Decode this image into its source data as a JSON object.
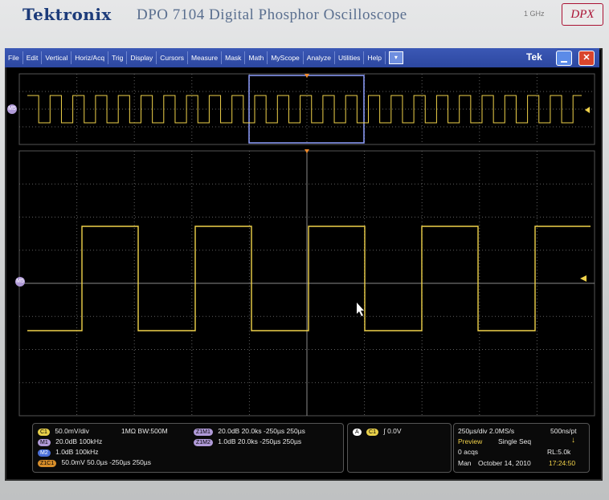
{
  "bezel": {
    "brand": "Tektronix",
    "model": "DPO 7104 Digital Phosphor Oscilloscope",
    "bandwidth": "1 GHz",
    "dpx_logo": "DPX"
  },
  "menu": [
    "File",
    "Edit",
    "Vertical",
    "Horiz/Acq",
    "Trig",
    "Display",
    "Cursors",
    "Measure",
    "Mask",
    "Math",
    "MyScope",
    "Analyze",
    "Utilities",
    "Help"
  ],
  "menu_dropdown_icon": "chevron-down-icon",
  "tek_label": "Tek",
  "close_label": "✕",
  "markers": {
    "zoom_marker": "M5",
    "main_marker": "M5"
  },
  "colors": {
    "trace": "#f0d24a",
    "grid": "#606060",
    "menubar": "#2c47a0",
    "zoom_box": "#8fa0ff"
  },
  "panel_left": {
    "c1": {
      "badge": "C1",
      "text": "50.0mV/div",
      "extra": "1MΩ  BW:500M"
    },
    "m1": {
      "badge": "M1",
      "text": "20.0dB  100kHz"
    },
    "m2": {
      "badge": "M2",
      "text": "1.0dB   100kHz"
    },
    "z1": {
      "badge": "Z1M1",
      "text": "20.0dB  20.0ks  -250µs   250µs"
    },
    "z2": {
      "badge": "Z1M2",
      "text": "1.0dB   20.0ks  -250µs   250µs"
    },
    "z3": {
      "badge": "Z1C1",
      "text": "50.0mV 50.0µs  -250µs   250µs"
    }
  },
  "panel_mid": {
    "badge_a": "A",
    "badge_c1": "C1",
    "trigger_text": "0.0V"
  },
  "panel_right": {
    "timebase": "250µs/div  2.0MS/s",
    "pts": "500ns/pt",
    "preview": "Preview",
    "mode": "Single Seq",
    "acqs": "0 acqs",
    "rl": "RL:5.0k",
    "man": "Man",
    "date": "October 14, 2010",
    "time": "17:24:50"
  }
}
